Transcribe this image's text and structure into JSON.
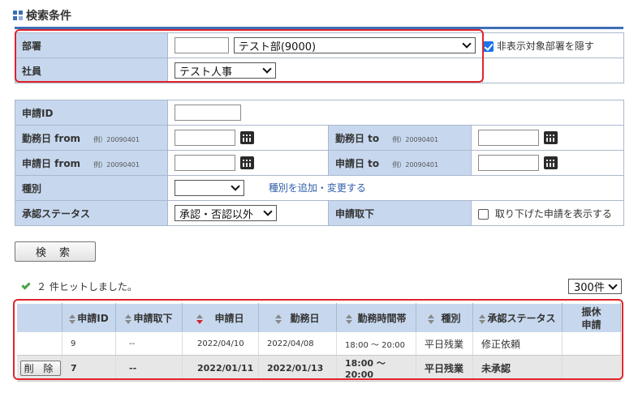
{
  "section_title": "検索条件",
  "dept_box": {
    "dept_label": "部署",
    "dept_code_value": "",
    "dept_select": "テスト部(9000)",
    "hide_checkbox_label": "非表示対象部署を隠す",
    "hide_checked": true,
    "emp_label": "社員",
    "emp_select": "テスト人事"
  },
  "criteria": {
    "apply_id_label": "申請ID",
    "work_from_label": "勤務日 from",
    "work_to_label": "勤務日 to",
    "apply_from_label": "申請日 from",
    "apply_to_label": "申請日 to",
    "date_example": "例）20090401",
    "type_label": "種別",
    "type_select": "",
    "type_link": "種別を追加・変更する",
    "status_label": "承認ステータス",
    "status_select": "承認・否認以外",
    "withdraw_label": "申請取下",
    "withdraw_checkbox_label": "取り下げた申請を表示する",
    "withdraw_checked": false
  },
  "search_button": "検 索",
  "hits_text": "２ 件ヒットしました。",
  "per_page": "300件",
  "results": {
    "headers": [
      "",
      "申請ID",
      "申請取下",
      "申請日",
      "勤務日",
      "勤務時間帯",
      "種別",
      "承認ステータス",
      "振休\n申請"
    ],
    "delete_label": "削 除",
    "rows": [
      {
        "id": "9",
        "withdraw": "--",
        "apply_date": "2022/04/10",
        "work_date": "2022/04/08",
        "time": "18:00 ～ 20:00",
        "type": "平日残業",
        "status": "修正依頼",
        "comp": ""
      },
      {
        "id": "7",
        "withdraw": "--",
        "apply_date": "2022/01/11",
        "work_date": "2022/01/13",
        "time": "18:00 ～ 20:00",
        "type": "平日残業",
        "status": "未承認",
        "comp": ""
      }
    ]
  },
  "colors": {
    "accent_red": "#e0242a",
    "label_bg": "#c7d8ee",
    "link": "#2f5ea8"
  }
}
